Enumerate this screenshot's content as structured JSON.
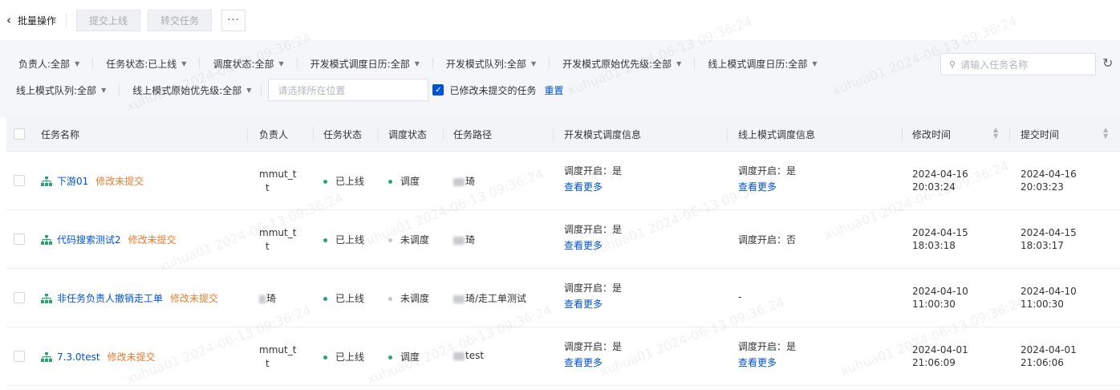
{
  "toolbar": {
    "back_label": "批量操作",
    "submit_online_label": "提交上线",
    "transfer_task_label": "转交任务",
    "more_label": "···"
  },
  "filters": {
    "owner": {
      "label": "负责人:",
      "value": "全部"
    },
    "task_status": {
      "label": "任务状态:",
      "value": "已上线"
    },
    "schedule_status": {
      "label": "调度状态:",
      "value": "全部"
    },
    "dev_calendar": {
      "label": "开发模式调度日历:",
      "value": "全部"
    },
    "dev_queue": {
      "label": "开发模式队列:",
      "value": "全部"
    },
    "dev_priority": {
      "label": "开发模式原始优先级:",
      "value": "全部"
    },
    "online_calendar": {
      "label": "线上模式调度日历:",
      "value": "全部"
    },
    "online_queue": {
      "label": "线上模式队列:",
      "value": "全部"
    },
    "online_priority": {
      "label": "线上模式原始优先级:",
      "value": "全部"
    },
    "location_placeholder": "请选择所在位置",
    "modified_checkbox_label": "已修改未提交的任务",
    "reset_label": "重置",
    "search_placeholder": "请输入任务名称"
  },
  "table": {
    "headers": {
      "name": "任务名称",
      "owner": "负责人",
      "task_status": "任务状态",
      "schedule_status": "调度状态",
      "path": "任务路径",
      "dev_info": "开发模式调度信息",
      "online_info": "线上模式调度信息",
      "modified_time": "修改时间",
      "submit_time": "提交时间"
    },
    "rows": [
      {
        "name": "下游01",
        "tag": "修改未提交",
        "owner_l1": "mmut_t",
        "owner_l2": "t",
        "task_status": "已上线",
        "schedule_status": "调度",
        "path": "琦",
        "dev_info": "调度开启：是",
        "dev_more": "查看更多",
        "online_info": "调度开启：是",
        "online_more": "查看更多",
        "modified_date": "2024-04-16",
        "modified_clock": "20:03:24",
        "submit_date": "2024-04-16",
        "submit_clock": "20:03:23"
      },
      {
        "name": "代码搜索测试2",
        "tag": "修改未提交",
        "owner_l1": "mmut_t",
        "owner_l2": "t",
        "task_status": "已上线",
        "schedule_status": "未调度",
        "path": "琦",
        "dev_info": "调度开启：是",
        "dev_more": "查看更多",
        "online_info": "调度开启：否",
        "online_more": "",
        "modified_date": "2024-04-15",
        "modified_clock": "18:03:18",
        "submit_date": "2024-04-15",
        "submit_clock": "18:03:17"
      },
      {
        "name": "非任务负责人撤销走工单",
        "tag": "修改未提交",
        "owner_l1": "琦",
        "owner_l2": "",
        "task_status": "已上线",
        "schedule_status": "未调度",
        "path": "琦/走工单测试",
        "dev_info": "调度开启：是",
        "dev_more": "查看更多",
        "online_info": "-",
        "online_more": "",
        "modified_date": "2024-04-10",
        "modified_clock": "11:00:30",
        "submit_date": "2024-04-10",
        "submit_clock": "11:00:30"
      },
      {
        "name": "7.3.0test",
        "tag": "修改未提交",
        "owner_l1": "mmut_t",
        "owner_l2": "t",
        "task_status": "已上线",
        "schedule_status": "调度",
        "path": "test",
        "dev_info": "调度开启：是",
        "dev_more": "查看更多",
        "online_info": "调度开启：是",
        "online_more": "查看更多",
        "modified_date": "2024-04-01",
        "modified_clock": "21:06:09",
        "submit_date": "2024-04-01",
        "submit_clock": "21:06:06"
      }
    ]
  },
  "watermark": "xuhua01 2024-06-13 09:36:24",
  "colors": {
    "primary": "#0052d9",
    "success": "#2ba471",
    "warning": "#ed7b2f",
    "muted": "#c5c8ce"
  },
  "icons": {
    "back": "chevron-left-icon",
    "search": "search-icon",
    "refresh": "refresh-icon",
    "task": "tree-node-icon",
    "sort": "sort-icon"
  }
}
